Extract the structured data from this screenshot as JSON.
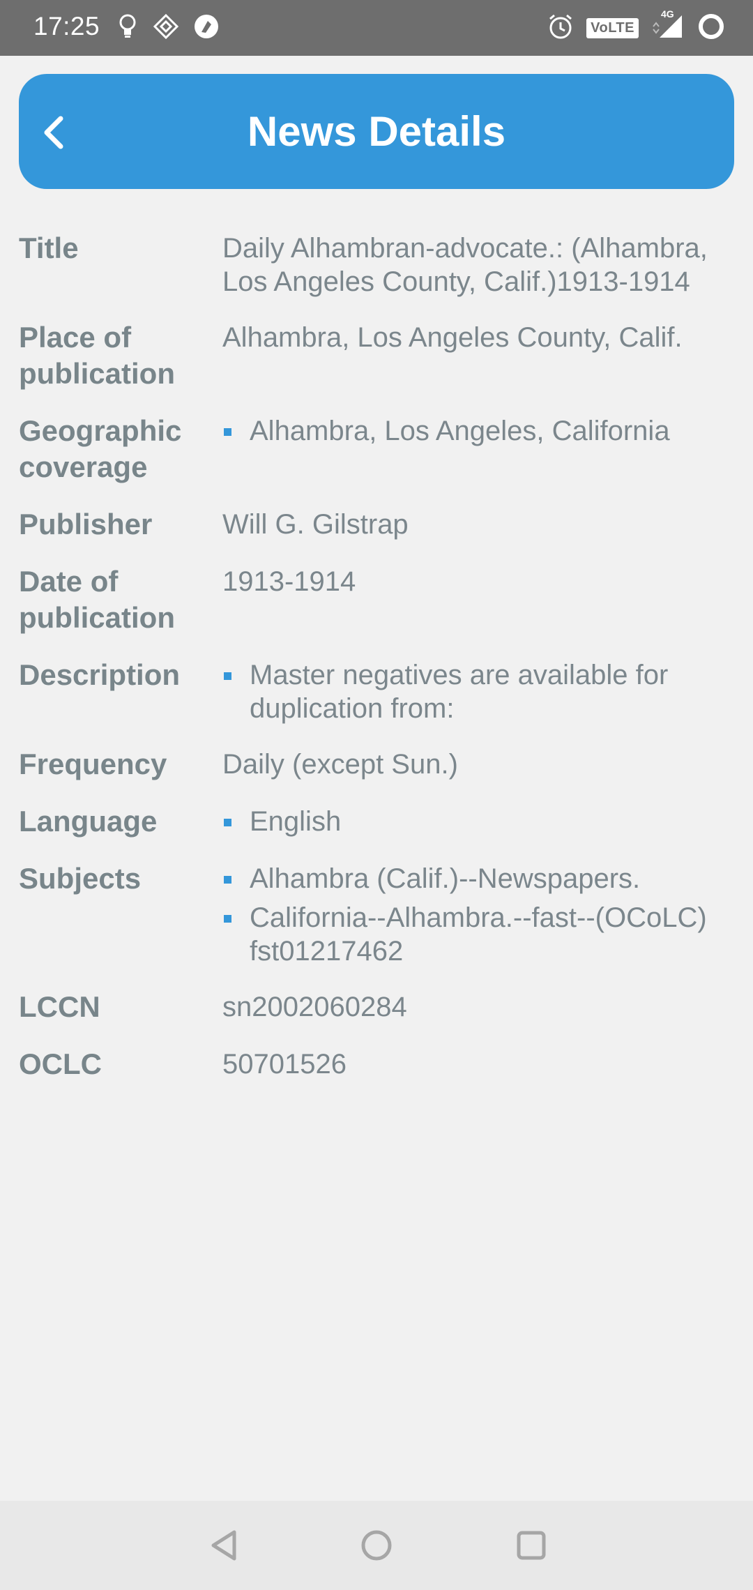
{
  "status_bar": {
    "time": "17:25",
    "left_icons": [
      "bulb-icon",
      "diamond-app-icon",
      "app-shortcut-icon"
    ],
    "right_icons": [
      "alarm-icon",
      "volte-badge",
      "signal-4g-icon",
      "battery-ring-icon"
    ],
    "volte_label": "VoLTE",
    "network_label": "4G"
  },
  "app_bar": {
    "title": "News Details",
    "accent_color": "#3497da"
  },
  "details": {
    "title": {
      "label": "Title",
      "value": "Daily Alhambran-advocate.: (Alhambra, Los Angeles County, Calif.)1913-1914"
    },
    "place": {
      "label": "Place of publication",
      "value": "Alhambra, Los Angeles County, Calif."
    },
    "geographic": {
      "label": "Geographic coverage",
      "items": [
        "Alhambra, Los Angeles, California"
      ]
    },
    "publisher": {
      "label": "Publisher",
      "value": "Will G. Gilstrap"
    },
    "date": {
      "label": "Date of publication",
      "value": "1913-1914"
    },
    "description": {
      "label": "Description",
      "items": [
        "Master negatives are available for duplication from:"
      ]
    },
    "frequency": {
      "label": "Frequency",
      "value": "Daily (except Sun.)"
    },
    "language": {
      "label": "Language",
      "items": [
        "English"
      ]
    },
    "subjects": {
      "label": "Subjects",
      "items": [
        "Alhambra (Calif.)--Newspapers.",
        "California--Alhambra.--fast--(OCoLC) fst01217462"
      ]
    },
    "lccn": {
      "label": "LCCN",
      "value": "sn2002060284"
    },
    "oclc": {
      "label": "OCLC",
      "value": "50701526"
    }
  },
  "nav_bar": {
    "buttons": [
      "back-triangle-icon",
      "home-circle-icon",
      "recents-square-icon"
    ]
  }
}
